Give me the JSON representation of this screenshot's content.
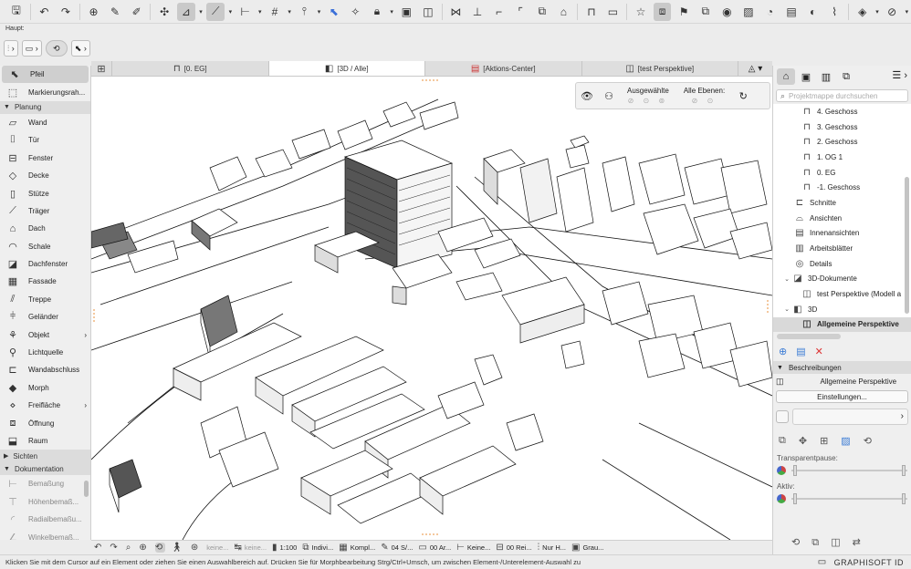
{
  "toolbar": {
    "icons": [
      "save-icon",
      "undo-icon",
      "redo-icon",
      "pick-up-icon",
      "eyedropper-icon",
      "inject-icon",
      "snap-icon",
      "trace-icon",
      "guide-line-icon",
      "align-icon",
      "grid-icon",
      "gravity-icon",
      "selection-icon",
      "magic-wand-icon",
      "lock-icon",
      "group-icon",
      "suspend-group-icon",
      "mirror-icon",
      "rotate-icon",
      "trim-icon",
      "split-icon",
      "offset-icon",
      "3d-icon",
      "floor-plan-icon",
      "favorites-icon",
      "view-toggle-icon",
      "flag-icon",
      "copy-icon",
      "layers-icon",
      "render-icon",
      "image-icon",
      "teamwork-icon",
      "share-icon",
      "more-icon",
      "compass-icon"
    ]
  },
  "haupt": {
    "label": "Haupt:"
  },
  "left_panel": {
    "top_tools": [
      {
        "label": "Pfeil",
        "icon": "arrow-icon",
        "selected": true
      },
      {
        "label": "Markierungsrah...",
        "icon": "marquee-icon"
      }
    ],
    "sections": {
      "planung": "Planung",
      "sichten": "Sichten",
      "dokumentation": "Dokumentation"
    },
    "planung_tools": [
      {
        "label": "Wand",
        "icon": "wall-icon"
      },
      {
        "label": "Tür",
        "icon": "door-icon"
      },
      {
        "label": "Fenster",
        "icon": "window-icon"
      },
      {
        "label": "Decke",
        "icon": "slab-icon"
      },
      {
        "label": "Stütze",
        "icon": "column-icon"
      },
      {
        "label": "Träger",
        "icon": "beam-icon"
      },
      {
        "label": "Dach",
        "icon": "roof-icon"
      },
      {
        "label": "Schale",
        "icon": "shell-icon"
      },
      {
        "label": "Dachfenster",
        "icon": "skylight-icon"
      },
      {
        "label": "Fassade",
        "icon": "curtain-wall-icon"
      },
      {
        "label": "Treppe",
        "icon": "stair-icon"
      },
      {
        "label": "Geländer",
        "icon": "railing-icon"
      },
      {
        "label": "Objekt",
        "icon": "object-icon",
        "arrow": "›"
      },
      {
        "label": "Lichtquelle",
        "icon": "lamp-icon"
      },
      {
        "label": "Wandabschluss",
        "icon": "wall-end-icon"
      },
      {
        "label": "Morph",
        "icon": "morph-icon"
      },
      {
        "label": "Freifläche",
        "icon": "mesh-icon",
        "arrow": "›"
      },
      {
        "label": "Öffnung",
        "icon": "opening-icon"
      },
      {
        "label": "Raum",
        "icon": "zone-icon"
      }
    ],
    "doc_tools": [
      {
        "label": "Bemaßung",
        "icon": "dimension-icon"
      },
      {
        "label": "Höhenbemaß...",
        "icon": "level-dimension-icon"
      },
      {
        "label": "Radialbemaßu...",
        "icon": "radial-dimension-icon"
      },
      {
        "label": "Winkelbemaß...",
        "icon": "angle-dimension-icon"
      }
    ]
  },
  "tabs": [
    {
      "label": "[0. EG]",
      "icon": "floor-plan-icon"
    },
    {
      "label": "[3D / Alle]",
      "icon": "3d-view-icon",
      "active": true
    },
    {
      "label": "[Aktions-Center]",
      "icon": "action-center-icon"
    },
    {
      "label": "[test Perspektive]",
      "icon": "perspective-icon"
    }
  ],
  "overlay": {
    "ausgewahlte": "Ausgewählte",
    "alle_ebenen": "Alle Ebenen:"
  },
  "bottombar": {
    "keine1": "keine...",
    "keine2": "keine...",
    "scale": "1:100",
    "indiv": "Indivi...",
    "kompl": "Kompl...",
    "s04": "04 S/...",
    "ar00": "00 Ar...",
    "keine3": "Keine...",
    "rei00": "00 Rei...",
    "nur": "Nur H...",
    "grau": "Grau..."
  },
  "status": {
    "text": "Klicken Sie mit dem Cursor auf ein Element oder ziehen Sie einen Auswahlbereich auf. Drücken Sie für Morphbearbeitung Strg/Ctrl+Umsch, um zwischen Element-/Unterelement-Auswahl zu",
    "brand": "GRAPHISOFT ID"
  },
  "right_panel": {
    "search_placeholder": "Projektmappe durchsuchen",
    "tree": [
      {
        "label": "4. Geschoss",
        "icon": "story-icon",
        "indent": 30
      },
      {
        "label": "3. Geschoss",
        "icon": "story-icon",
        "indent": 30
      },
      {
        "label": "2. Geschoss",
        "icon": "story-icon",
        "indent": 30
      },
      {
        "label": "1. OG 1",
        "icon": "story-icon",
        "indent": 30
      },
      {
        "label": "0. EG",
        "icon": "story-icon",
        "indent": 30
      },
      {
        "label": "-1. Geschoss",
        "icon": "story-icon",
        "indent": 30
      },
      {
        "label": "Schnitte",
        "icon": "section-icon",
        "indent": 22
      },
      {
        "label": "Ansichten",
        "icon": "elevation-icon",
        "indent": 22
      },
      {
        "label": "Innenansichten",
        "icon": "interior-elevation-icon",
        "indent": 22
      },
      {
        "label": "Arbeitsblätter",
        "icon": "worksheet-icon",
        "indent": 22
      },
      {
        "label": "Details",
        "icon": "detail-icon",
        "indent": 22
      },
      {
        "label": "3D-Dokumente",
        "icon": "3d-document-icon",
        "indent": 10,
        "toggle": "⌄"
      },
      {
        "label": "test Perspektive (Modell a",
        "icon": "perspective-icon",
        "indent": 30
      },
      {
        "label": "3D",
        "icon": "3d-view-icon",
        "indent": 10,
        "toggle": "⌄"
      },
      {
        "label": "Allgemeine Perspektive",
        "icon": "perspective-icon",
        "indent": 30,
        "selected": true
      }
    ],
    "beschreibungen": "Beschreibungen",
    "allgemeine": "Allgemeine Perspektive",
    "einstellungen": "Einstellungen...",
    "transparentpause": "Transparentpause:",
    "aktiv": "Aktiv:"
  }
}
